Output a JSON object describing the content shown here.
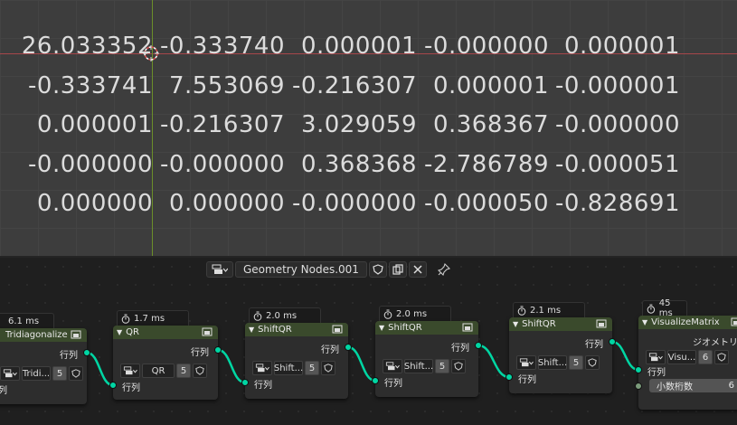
{
  "matrix": {
    "rows": [
      [
        "26.033352",
        "-0.333740",
        "0.000001",
        "-0.000000",
        "0.000001"
      ],
      [
        "-0.333741",
        "7.553069",
        "-0.216307",
        "0.000001",
        "-0.000001"
      ],
      [
        "0.000001",
        "-0.216307",
        "3.029059",
        "0.368367",
        "-0.000000"
      ],
      [
        "-0.000000",
        "-0.000000",
        "0.368368",
        "-2.786789",
        "-0.000051"
      ],
      [
        "0.000000",
        "0.000000",
        "-0.000000",
        "-0.000050",
        "-0.828691"
      ]
    ]
  },
  "header": {
    "tree_name": "Geometry Nodes.001",
    "icons": [
      "node-tree-icon",
      "shield-icon",
      "copy-icon",
      "close-icon",
      "pin-icon"
    ]
  },
  "nodes": [
    {
      "title": "Tridiagonalize",
      "timing": "6.1 ms",
      "output": "行列",
      "input": "行列",
      "field_value": "Tridi...",
      "count": "5"
    },
    {
      "title": "QR",
      "timing": "1.7 ms",
      "output": "行列",
      "input": "行列",
      "field_value": "QR",
      "count": "5"
    },
    {
      "title": "ShiftQR",
      "timing": "2.0 ms",
      "output": "行列",
      "input": "行列",
      "field_value": "Shift...",
      "count": "5"
    },
    {
      "title": "ShiftQR",
      "timing": "2.0 ms",
      "output": "行列",
      "input": "行列",
      "field_value": "Shift...",
      "count": "5"
    },
    {
      "title": "ShiftQR",
      "timing": "2.1 ms",
      "output": "行列",
      "input": "行列",
      "field_value": "Shift...",
      "count": "5"
    },
    {
      "title": "VisualizeMatrix",
      "timing": "45 ms",
      "output": "ジオメトリ",
      "input": "行列",
      "field_value": "Visu...",
      "count": "6",
      "extra_label": "小数桁数",
      "extra_value": "6"
    }
  ],
  "colors": {
    "link": "#00d6a3",
    "header": "#3a4a2c",
    "x_axis": "#a8464a",
    "y_axis": "#6b8f2a"
  }
}
